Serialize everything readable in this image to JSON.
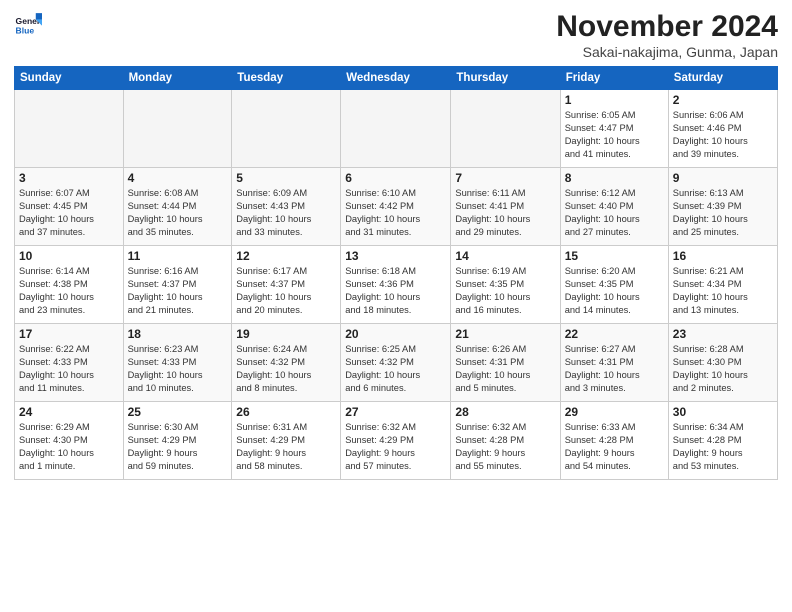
{
  "header": {
    "logo_line1": "General",
    "logo_line2": "Blue",
    "title": "November 2024",
    "location": "Sakai-nakajima, Gunma, Japan"
  },
  "weekdays": [
    "Sunday",
    "Monday",
    "Tuesday",
    "Wednesday",
    "Thursday",
    "Friday",
    "Saturday"
  ],
  "weeks": [
    [
      {
        "day": "",
        "info": ""
      },
      {
        "day": "",
        "info": ""
      },
      {
        "day": "",
        "info": ""
      },
      {
        "day": "",
        "info": ""
      },
      {
        "day": "",
        "info": ""
      },
      {
        "day": "1",
        "info": "Sunrise: 6:05 AM\nSunset: 4:47 PM\nDaylight: 10 hours\nand 41 minutes."
      },
      {
        "day": "2",
        "info": "Sunrise: 6:06 AM\nSunset: 4:46 PM\nDaylight: 10 hours\nand 39 minutes."
      }
    ],
    [
      {
        "day": "3",
        "info": "Sunrise: 6:07 AM\nSunset: 4:45 PM\nDaylight: 10 hours\nand 37 minutes."
      },
      {
        "day": "4",
        "info": "Sunrise: 6:08 AM\nSunset: 4:44 PM\nDaylight: 10 hours\nand 35 minutes."
      },
      {
        "day": "5",
        "info": "Sunrise: 6:09 AM\nSunset: 4:43 PM\nDaylight: 10 hours\nand 33 minutes."
      },
      {
        "day": "6",
        "info": "Sunrise: 6:10 AM\nSunset: 4:42 PM\nDaylight: 10 hours\nand 31 minutes."
      },
      {
        "day": "7",
        "info": "Sunrise: 6:11 AM\nSunset: 4:41 PM\nDaylight: 10 hours\nand 29 minutes."
      },
      {
        "day": "8",
        "info": "Sunrise: 6:12 AM\nSunset: 4:40 PM\nDaylight: 10 hours\nand 27 minutes."
      },
      {
        "day": "9",
        "info": "Sunrise: 6:13 AM\nSunset: 4:39 PM\nDaylight: 10 hours\nand 25 minutes."
      }
    ],
    [
      {
        "day": "10",
        "info": "Sunrise: 6:14 AM\nSunset: 4:38 PM\nDaylight: 10 hours\nand 23 minutes."
      },
      {
        "day": "11",
        "info": "Sunrise: 6:16 AM\nSunset: 4:37 PM\nDaylight: 10 hours\nand 21 minutes."
      },
      {
        "day": "12",
        "info": "Sunrise: 6:17 AM\nSunset: 4:37 PM\nDaylight: 10 hours\nand 20 minutes."
      },
      {
        "day": "13",
        "info": "Sunrise: 6:18 AM\nSunset: 4:36 PM\nDaylight: 10 hours\nand 18 minutes."
      },
      {
        "day": "14",
        "info": "Sunrise: 6:19 AM\nSunset: 4:35 PM\nDaylight: 10 hours\nand 16 minutes."
      },
      {
        "day": "15",
        "info": "Sunrise: 6:20 AM\nSunset: 4:35 PM\nDaylight: 10 hours\nand 14 minutes."
      },
      {
        "day": "16",
        "info": "Sunrise: 6:21 AM\nSunset: 4:34 PM\nDaylight: 10 hours\nand 13 minutes."
      }
    ],
    [
      {
        "day": "17",
        "info": "Sunrise: 6:22 AM\nSunset: 4:33 PM\nDaylight: 10 hours\nand 11 minutes."
      },
      {
        "day": "18",
        "info": "Sunrise: 6:23 AM\nSunset: 4:33 PM\nDaylight: 10 hours\nand 10 minutes."
      },
      {
        "day": "19",
        "info": "Sunrise: 6:24 AM\nSunset: 4:32 PM\nDaylight: 10 hours\nand 8 minutes."
      },
      {
        "day": "20",
        "info": "Sunrise: 6:25 AM\nSunset: 4:32 PM\nDaylight: 10 hours\nand 6 minutes."
      },
      {
        "day": "21",
        "info": "Sunrise: 6:26 AM\nSunset: 4:31 PM\nDaylight: 10 hours\nand 5 minutes."
      },
      {
        "day": "22",
        "info": "Sunrise: 6:27 AM\nSunset: 4:31 PM\nDaylight: 10 hours\nand 3 minutes."
      },
      {
        "day": "23",
        "info": "Sunrise: 6:28 AM\nSunset: 4:30 PM\nDaylight: 10 hours\nand 2 minutes."
      }
    ],
    [
      {
        "day": "24",
        "info": "Sunrise: 6:29 AM\nSunset: 4:30 PM\nDaylight: 10 hours\nand 1 minute."
      },
      {
        "day": "25",
        "info": "Sunrise: 6:30 AM\nSunset: 4:29 PM\nDaylight: 9 hours\nand 59 minutes."
      },
      {
        "day": "26",
        "info": "Sunrise: 6:31 AM\nSunset: 4:29 PM\nDaylight: 9 hours\nand 58 minutes."
      },
      {
        "day": "27",
        "info": "Sunrise: 6:32 AM\nSunset: 4:29 PM\nDaylight: 9 hours\nand 57 minutes."
      },
      {
        "day": "28",
        "info": "Sunrise: 6:32 AM\nSunset: 4:28 PM\nDaylight: 9 hours\nand 55 minutes."
      },
      {
        "day": "29",
        "info": "Sunrise: 6:33 AM\nSunset: 4:28 PM\nDaylight: 9 hours\nand 54 minutes."
      },
      {
        "day": "30",
        "info": "Sunrise: 6:34 AM\nSunset: 4:28 PM\nDaylight: 9 hours\nand 53 minutes."
      }
    ]
  ]
}
